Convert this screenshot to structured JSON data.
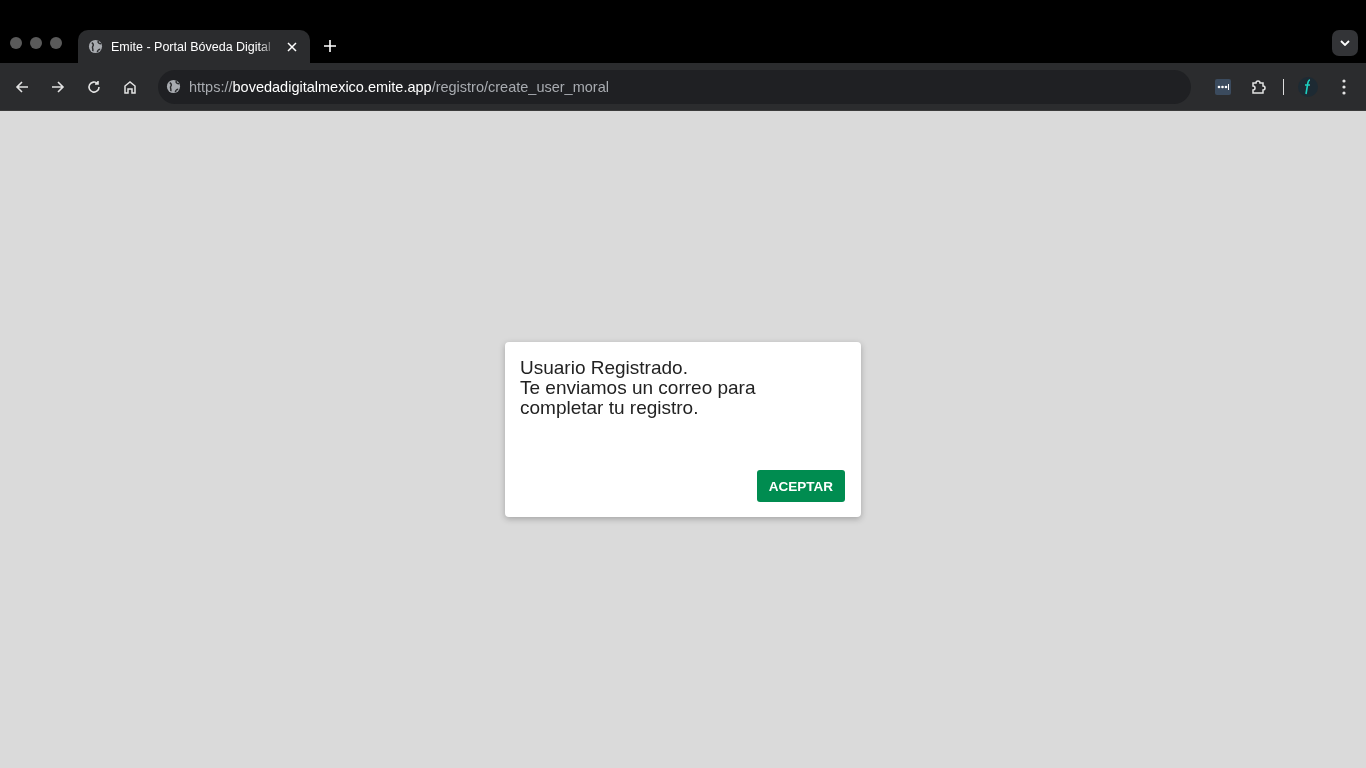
{
  "browser": {
    "tabs": [
      {
        "title": "Emite - Portal Bóveda Digital",
        "selected": true
      }
    ],
    "address_bar": {
      "scheme": "https://",
      "host": "bovedadigitalmexico.emite.app",
      "path": "/registro/create_user_moral"
    }
  },
  "dialog": {
    "title": "Usuario Registrado.",
    "message": "Te enviamos un correo para completar tu registro.",
    "buttons": [
      "ACEPTAR"
    ]
  }
}
